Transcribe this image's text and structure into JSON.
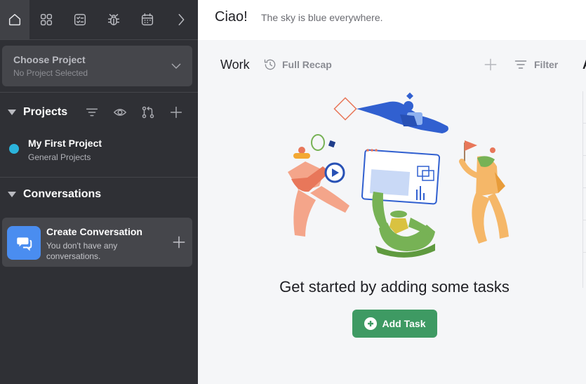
{
  "sidebar": {
    "nav_icons": [
      "home-icon",
      "grid-icon",
      "checklist-icon",
      "bug-icon",
      "calendar-icon",
      "chevron-right-icon"
    ],
    "project_select": {
      "label": "Choose Project",
      "value": "No Project Selected"
    },
    "projects": {
      "title": "Projects",
      "items": [
        {
          "name": "My First Project",
          "group": "General Projects",
          "color": "#2bb4dc"
        }
      ]
    },
    "conversations": {
      "title": "Conversations",
      "create_label": "Create Conversation",
      "empty_text": "You don't have any conversations."
    }
  },
  "header": {
    "greeting": "Ciao!",
    "motto": "The sky is blue everywhere."
  },
  "work": {
    "title": "Work",
    "recap_label": "Full Recap",
    "filter_label": "Filter",
    "cut_letter": "A"
  },
  "empty_state": {
    "title": "Get started by adding some tasks",
    "button_label": "Add Task"
  },
  "colors": {
    "sidebar_bg": "#2f3035",
    "accent_green": "#3e9a63",
    "accent_blue": "#4a8df0"
  }
}
